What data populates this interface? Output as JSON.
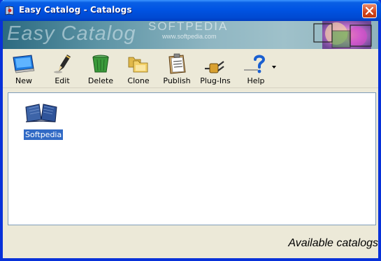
{
  "window": {
    "title": "Easy Catalog - Catalogs"
  },
  "banner": {
    "title": "Easy Catalog",
    "watermark": "SOFTPEDIA",
    "watermark_url": "www.softpedia.com"
  },
  "toolbar": {
    "buttons": [
      {
        "label": "New",
        "icon": "monitor-icon"
      },
      {
        "label": "Edit",
        "icon": "pencil-icon"
      },
      {
        "label": "Delete",
        "icon": "trash-can-icon"
      },
      {
        "label": "Clone",
        "icon": "folders-icon"
      },
      {
        "label": "Publish",
        "icon": "clipboard-icon"
      },
      {
        "label": "Plug-Ins",
        "icon": "plug-icon"
      },
      {
        "label": "Help",
        "icon": "question-mark-icon"
      }
    ]
  },
  "catalogs": [
    {
      "name": "Softpedia",
      "icon": "open-book-icon",
      "selected": true
    }
  ],
  "status": {
    "text": "Available catalogs"
  },
  "colors": {
    "titlebar": "#0054e3",
    "selection": "#316ac5",
    "window_bg": "#ece9d8"
  }
}
